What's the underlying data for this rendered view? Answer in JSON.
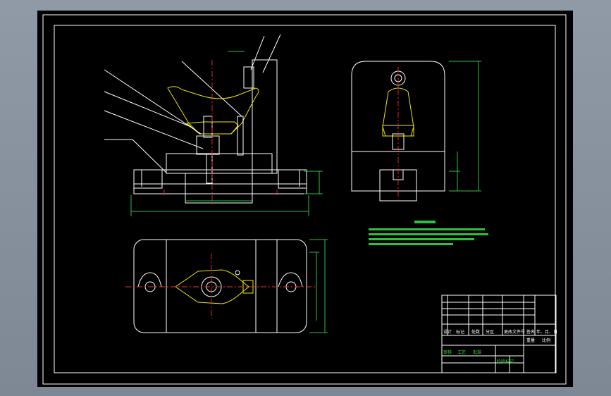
{
  "drawing": {
    "title_block": {
      "cells": [
        "设计",
        "标记",
        "处数",
        "分区",
        "更改文件号",
        "签名",
        "年、月、日",
        "审核",
        "工艺",
        "批准",
        "阶段标记",
        "重量",
        "比例"
      ]
    }
  },
  "colors": {
    "background": "#000000",
    "outline": "#ffffff",
    "hatch": "#20b2aa",
    "centerline": "#ff2a2a",
    "dimension": "#30c040",
    "highlight": "#f2e600",
    "window": "#8f9aa6"
  }
}
